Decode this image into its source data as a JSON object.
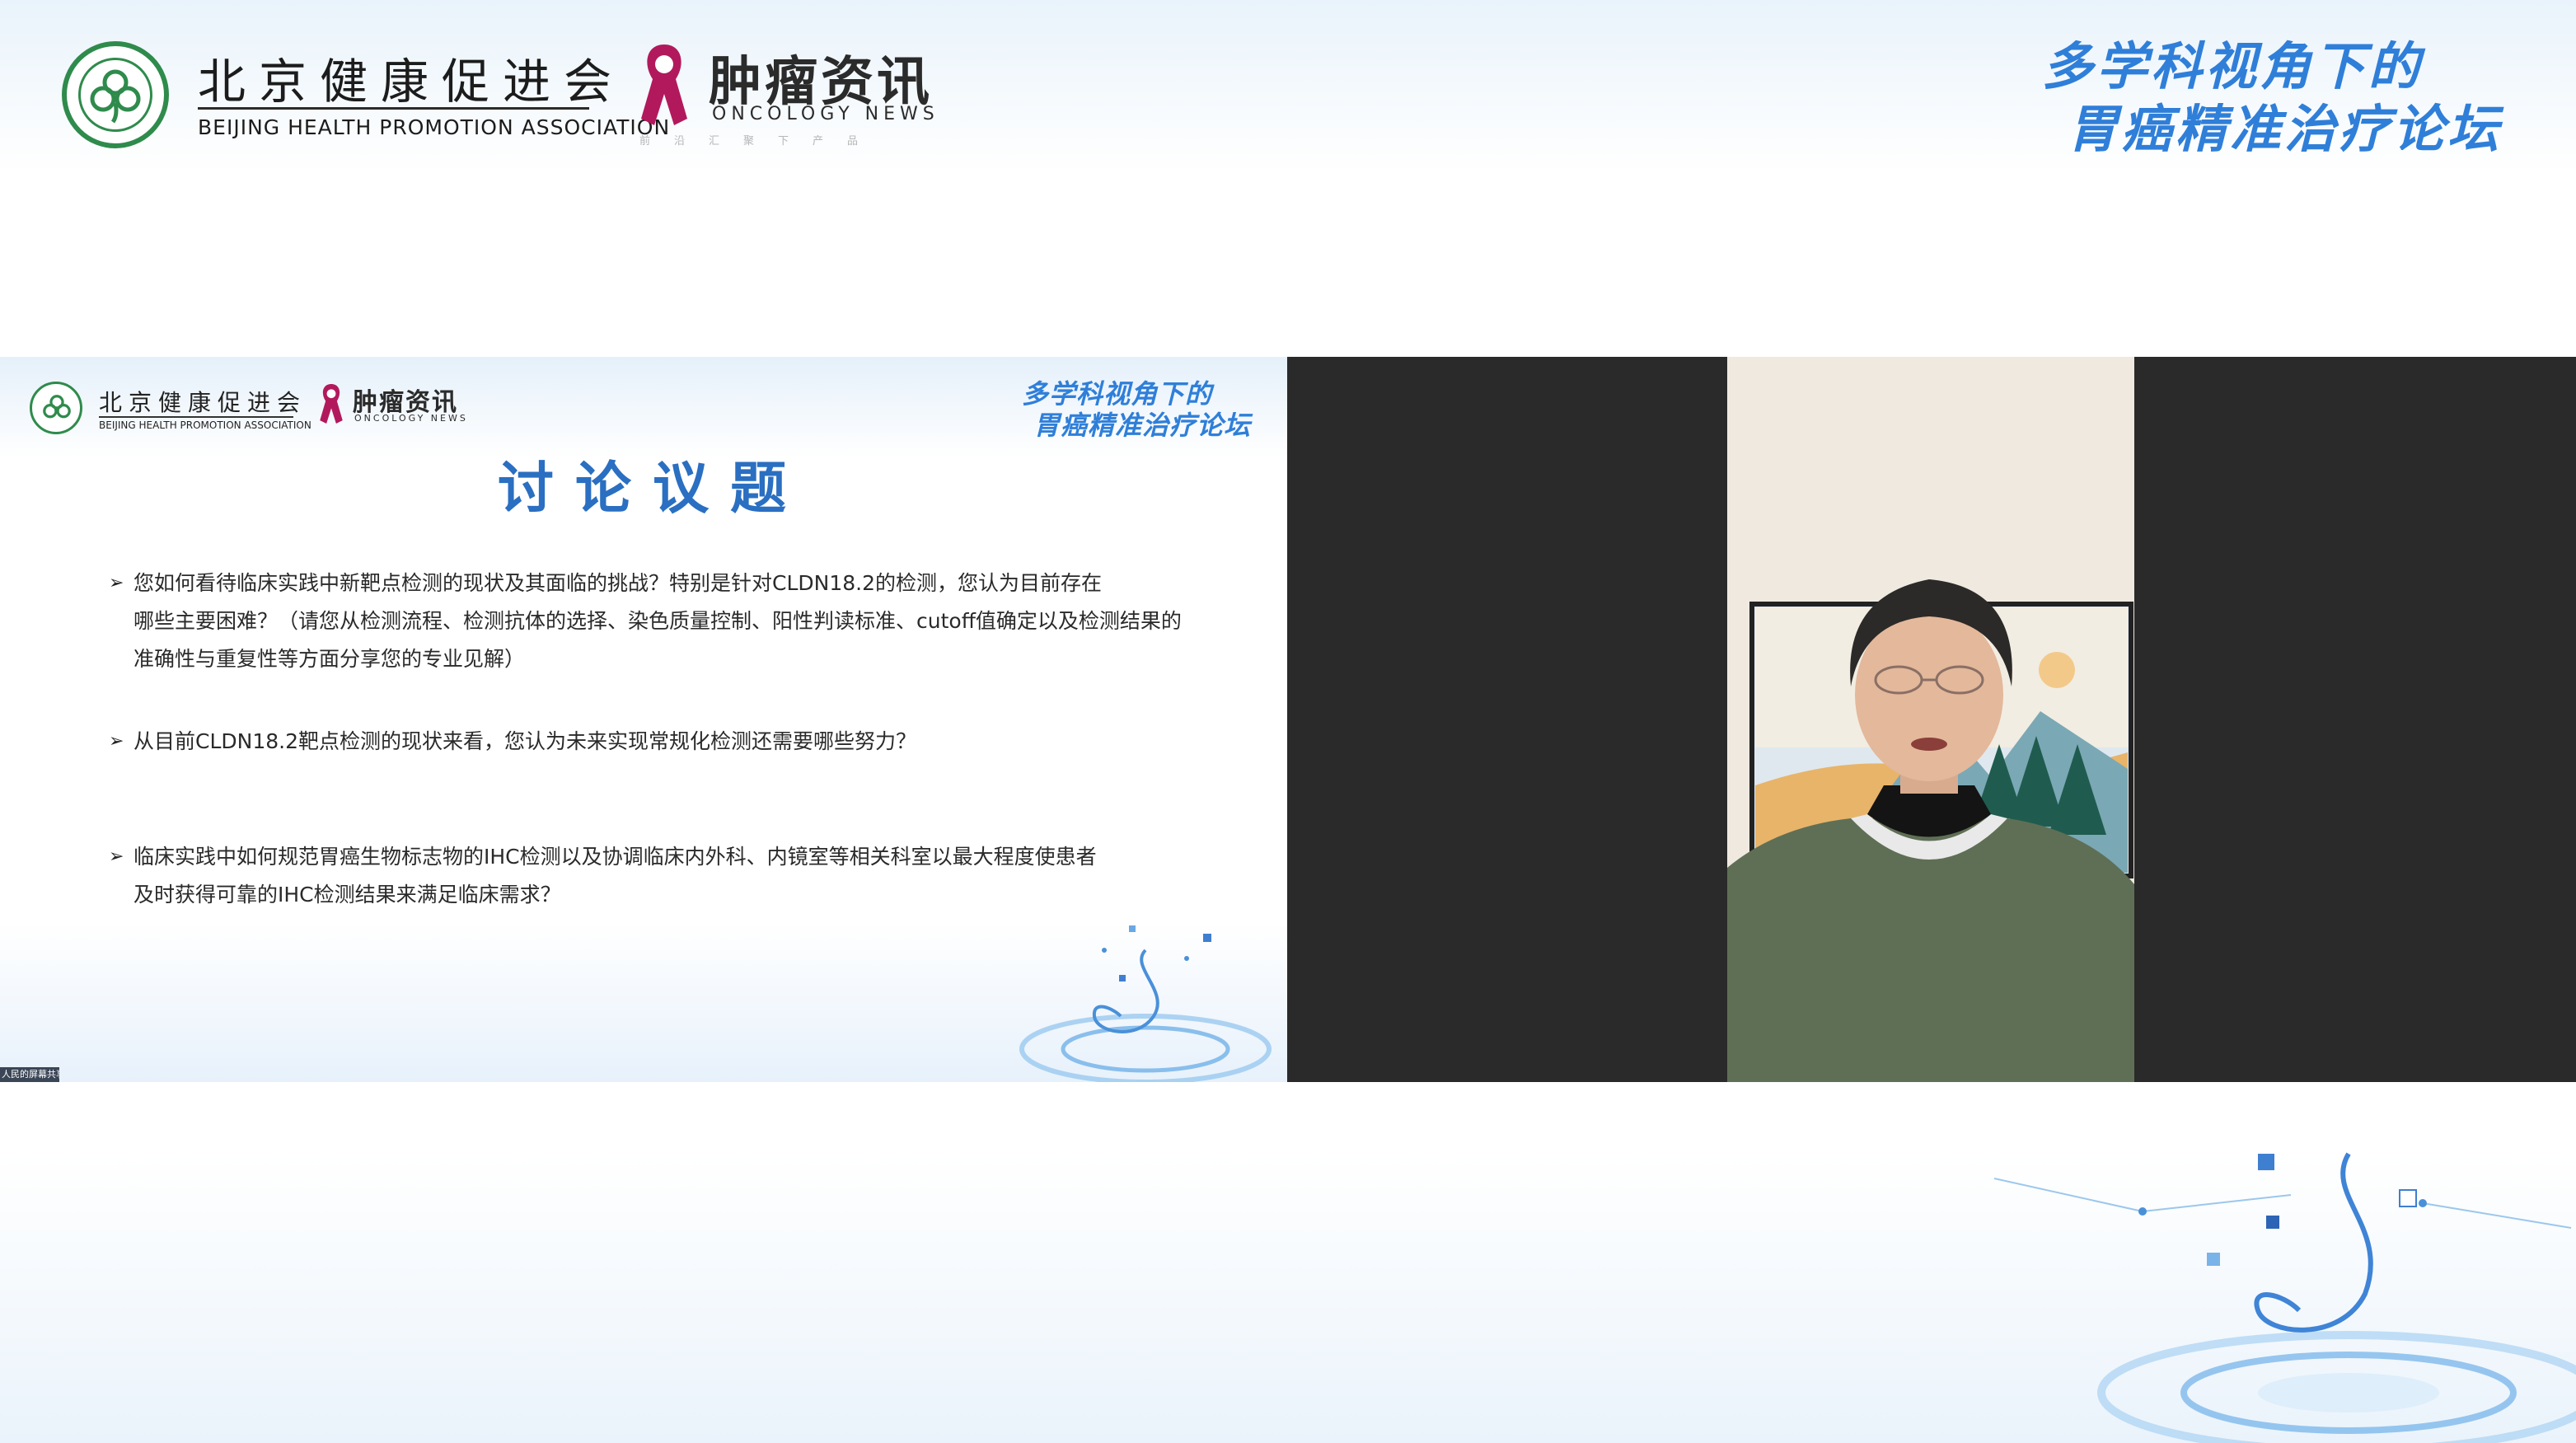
{
  "header": {
    "association_name_cn": "北京健康促进会",
    "association_name_en": "BEIJING HEALTH PROMOTION ASSOCIATION",
    "oncology_name_cn": "肿瘤资讯",
    "oncology_name_en": "ONCOLOGY NEWS",
    "oncology_tagline": "前沿汇聚下产品",
    "forum_title_line1": "多学科视角下的",
    "forum_title_line2": "胃癌精准治疗论坛"
  },
  "slide": {
    "association_name_cn": "北京健康促进会",
    "association_name_en": "BEIJING HEALTH PROMOTION ASSOCIATION",
    "oncology_name_cn": "肿瘤资讯",
    "oncology_name_en": "ONCOLOGY NEWS",
    "forum_title_line1": "多学科视角下的",
    "forum_title_line2": "胃癌精准治疗论坛",
    "title": "讨论议题",
    "bullet_marker": "➢",
    "bullets": [
      {
        "lines": [
          "您如何看待临床实践中新靶点检测的现状及其面临的挑战？特别是针对CLDN18.2的检测，您认为目前存在",
          "哪些主要困难？（请您从检测流程、检测抗体的选择、染色质量控制、阳性判读标准、cutoff值确定以及检测结果的",
          "准确性与重复性等方面分享您的专业见解）"
        ]
      },
      {
        "lines": [
          "从目前CLDN18.2靶点检测的现状来看，您认为未来实现常规化检测还需要哪些努力？"
        ]
      },
      {
        "lines": [
          "临床实践中如何规范胃癌生物标志物的IHC检测以及协调临床内外科、内镜室等相关科室以最大程度使患者",
          "及时获得可靠的IHC检测结果来满足临床需求？"
        ]
      }
    ],
    "share_badge": "人民的屏幕共享"
  },
  "video": {
    "participant": "speaker-video"
  },
  "colors": {
    "brand_blue": "#2f7fd9",
    "title_blue": "#2a6fc1",
    "association_green": "#2f8b4c",
    "oncology_magenta": "#b2195c",
    "video_bg": "#2a2a2a"
  }
}
